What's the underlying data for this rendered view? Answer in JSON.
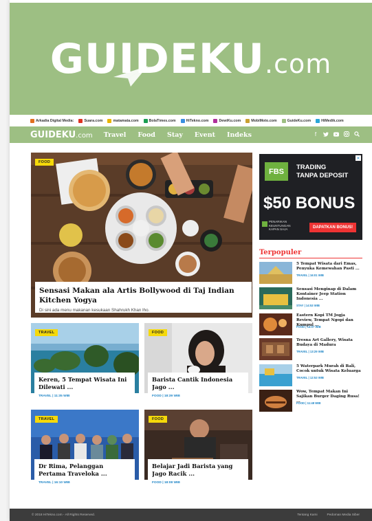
{
  "brand": {
    "hero_name": "GUIDEKU",
    "hero_suffix": ".com",
    "nav_name": "GUIDEKU",
    "nav_suffix": ".com",
    "color": "#9dbf83"
  },
  "partners": {
    "lead": "Arkadia Digital Media:",
    "items": [
      "Suara.com",
      "matamata.com",
      "BolaTimes.com",
      "HiTekno.com",
      "DewiKu.com",
      "MobiMoto.com",
      "GuideKu.com",
      "HiMedik.com"
    ]
  },
  "nav": {
    "items": [
      "Travel",
      "Food",
      "Stay",
      "Event",
      "Indeks"
    ],
    "icons": [
      "facebook-icon",
      "twitter-icon",
      "youtube-icon",
      "instagram-icon",
      "search-icon"
    ]
  },
  "featured": {
    "tag": "FOOD",
    "title": "Sensasi Makan ala Artis Bollywood di Taj Indian Kitchen Yogya",
    "subtitle": "Di sini ada menu makanan kesukaan Shahrukh Khan lho."
  },
  "cards": [
    {
      "tag": "TRAVEL",
      "title": "Keren, 5 Tempat Wisata Ini Dilewati ...",
      "category": "TRAVEL",
      "time": "11:35 WIB"
    },
    {
      "tag": "FOOD",
      "title": "Barista Cantik Indonesia Jago ...",
      "category": "FOOD",
      "time": "18:39 WIB"
    },
    {
      "tag": "TRAVEL",
      "title": "Dr Rima, Pelanggan Pertama Traveloka ...",
      "category": "TRAVEL",
      "time": "16:10 WIB"
    },
    {
      "tag": "FOOD",
      "title": "Belajar Jadi Barista yang Jago Racik ...",
      "category": "FOOD",
      "time": "18:08 WIB"
    }
  ],
  "ad": {
    "logo": "FBS",
    "line1": "TRADING",
    "line2": "TANPA DEPOSIT",
    "bonus": "$50 BONUS",
    "small1": "PENARIKAN",
    "small2": "KEUNTUNGAN",
    "small3": "KAPAN SAJA",
    "button": "DAPATKAN BONUS!"
  },
  "popular": {
    "heading": "Terpopuler",
    "items": [
      {
        "title": "5 Tempat Wisata dari Emas, Penyuka Kemewahan Pasti ...",
        "category": "TRAVEL",
        "time": "16:01 WIB"
      },
      {
        "title": "Sensasi Menginap di Dalam Kontainer Jeep Station Indonesia ...",
        "category": "STAY",
        "time": "14:53 WIB"
      },
      {
        "title": "Eastern Kopi TM Jogja Review, Tempat Ngopi dan Kumpul ...",
        "category": "FOOD",
        "time": "14:07 WIB"
      },
      {
        "title": "Tresna Art Gallery, Wisata Budaya di Madura",
        "category": "TRAVEL",
        "time": "13:29 WIB"
      },
      {
        "title": "5 Waterpark Murah di Bali, Cocok untuk Wisata Keluarga",
        "category": "TRAVEL",
        "time": "12:53 WIB"
      },
      {
        "title": "Wow, Tempat Makan Ini Sajikan Burger Daging Rusa! ...",
        "category": "FOOD",
        "time": "11:48 WIB"
      }
    ]
  },
  "footer": {
    "copyright": "© 2018 HiTekno.com - All Rights Reserved.",
    "link1": "Tentang Kami",
    "link2": "Pedoman Media Siber"
  }
}
